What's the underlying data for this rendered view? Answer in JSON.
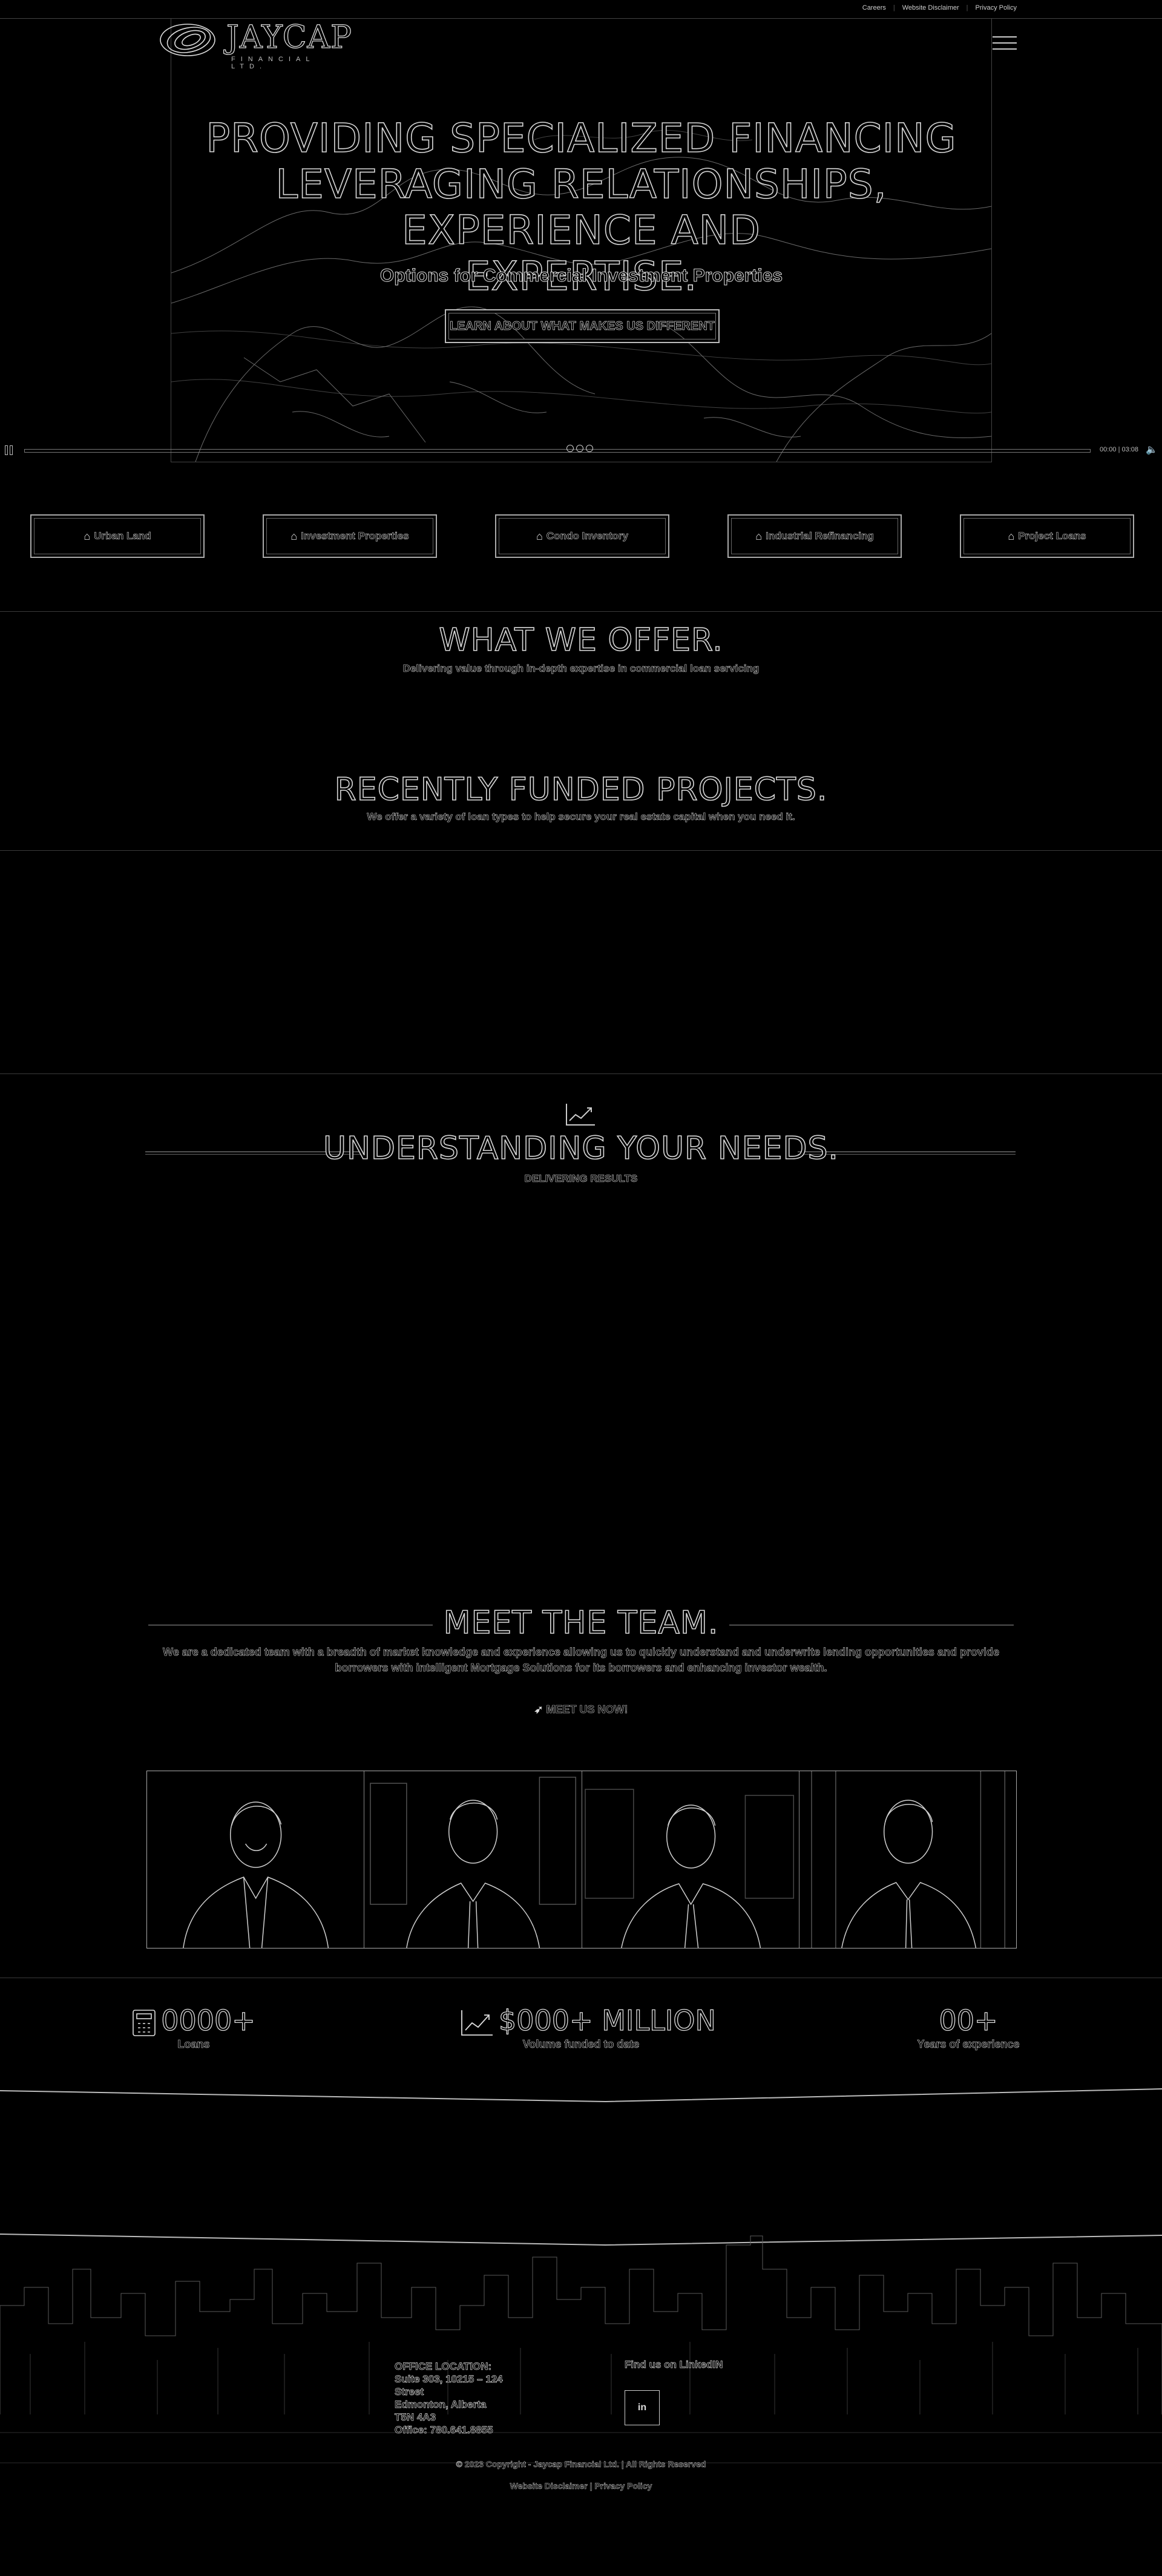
{
  "topbar": {
    "links": [
      "Careers",
      "Website Disclaimer",
      "Privacy Policy"
    ]
  },
  "logo": {
    "name": "JAYCAP",
    "tagline": "FINANCIAL LTD."
  },
  "hero": {
    "title_lines": [
      "PROVIDING SPECIALIZED FINANCING",
      "LEVERAGING RELATIONSHIPS, EXPERIENCE AND",
      "EXPERTISE."
    ],
    "subtitle": "Options for Commercial Investment Properties",
    "cta_label": "LEARN ABOUT WHAT MAKES US DIFFERENT"
  },
  "video_controls": {
    "time": "00:00 | 03:08"
  },
  "categories": [
    "Urban Land",
    "Investment Properties",
    "Condo Inventory",
    "Industrial Refinancing",
    "Project Loans"
  ],
  "offer": {
    "title": "WHAT WE OFFER.",
    "subtitle": "Delivering value through in-depth expertise in commercial loan servicing"
  },
  "projects": {
    "title": "RECENTLY FUNDED PROJECTS.",
    "subtitle": "We offer a variety of loan types to help secure your real estate capital when you need it."
  },
  "understanding": {
    "title": "UNDERSTANDING YOUR NEEDS.",
    "subtitle": "DELIVERING RESULTS"
  },
  "team": {
    "title": "MEET THE TEAM.",
    "description": "We are a dedicated team with a breadth of market knowledge and experience allowing us to quickly understand and underwrite lending opportunities and provide borrowers with intelligent Mortgage Solutions for its borrowers and enhancing investor wealth.",
    "cta_label": "MEET US NOW!",
    "member_count": 4
  },
  "stats": [
    {
      "value": "0000+",
      "label": "Loans",
      "icon": "calculator-icon"
    },
    {
      "value": "$000+ MILLION",
      "label": "Volume funded to date",
      "icon": "chart-line-icon"
    },
    {
      "value": "00+",
      "label": "Years of experience",
      "icon": ""
    }
  ],
  "footer": {
    "office_heading": "OFFICE LOCATION:",
    "office_lines": [
      "Suite 303, 10215 – 124",
      "Street",
      "Edmonton, Alberta",
      "T5N 4A3",
      "Office: 780.641.8855"
    ],
    "linkedin_label": "Find us on LinkedIN",
    "linkedin_icon_text": "in",
    "copyright": "© 2023 Copyright - Jaycap Financial Ltd. | All Rights Reserved",
    "links": "Website Disclaimer | Privacy Policy"
  }
}
